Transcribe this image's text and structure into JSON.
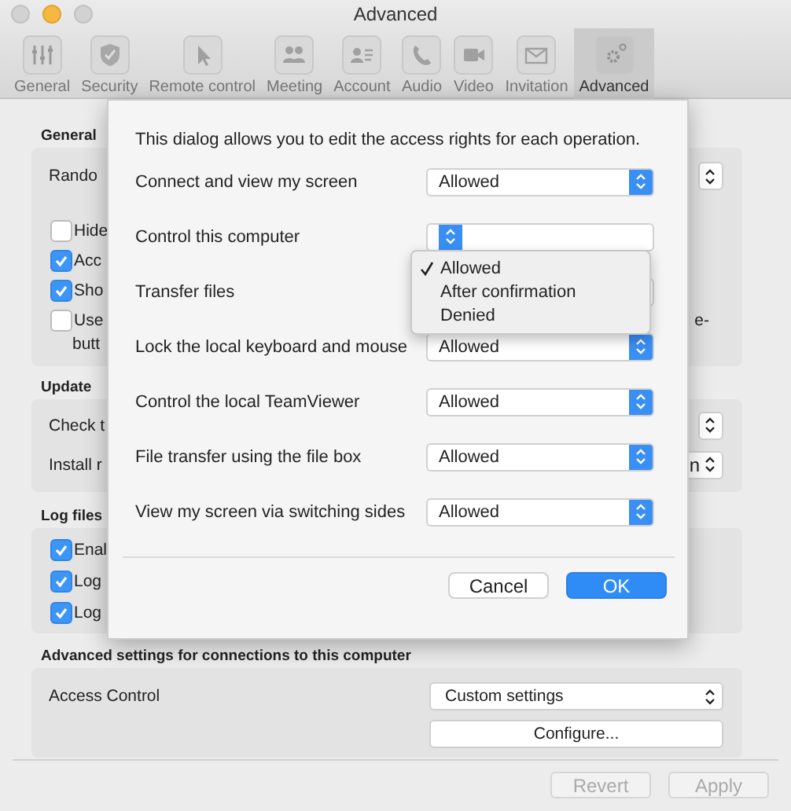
{
  "window": {
    "title": "Advanced"
  },
  "tabs": [
    {
      "label": "General",
      "selected": false
    },
    {
      "label": "Security",
      "selected": false
    },
    {
      "label": "Remote control",
      "selected": false
    },
    {
      "label": "Meeting",
      "selected": false
    },
    {
      "label": "Account",
      "selected": false
    },
    {
      "label": "Audio",
      "selected": false
    },
    {
      "label": "Video",
      "selected": false
    },
    {
      "label": "Invitation",
      "selected": false
    },
    {
      "label": "Advanced",
      "selected": true
    }
  ],
  "general": {
    "header": "General",
    "rows": [
      {
        "kind": "select",
        "label": "Rando"
      },
      {
        "kind": "checkbox",
        "label": "Hide",
        "checked": false
      },
      {
        "kind": "checkbox",
        "label": "Acc",
        "checked": true
      },
      {
        "kind": "checkbox",
        "label": "Sho",
        "checked": true
      },
      {
        "kind": "checkbox",
        "label": "Use",
        "checked": false,
        "continuation": "butt",
        "trailing": "e-"
      }
    ]
  },
  "update": {
    "header": "Update",
    "rows": [
      {
        "kind": "select",
        "label": "Check t"
      },
      {
        "kind": "select",
        "label": "Install r",
        "value": "n"
      }
    ]
  },
  "log_files": {
    "header": "Log files",
    "rows": [
      {
        "kind": "checkbox",
        "label": "Enal",
        "checked": true
      },
      {
        "kind": "checkbox",
        "label": "Log",
        "checked": true
      },
      {
        "kind": "checkbox",
        "label": "Log",
        "checked": true
      }
    ]
  },
  "advanced_settings": {
    "header": "Advanced settings for connections to this computer",
    "access_control": {
      "label": "Access Control",
      "value": "Custom settings"
    },
    "configure_button": "Configure..."
  },
  "footer_buttons": [
    {
      "label": "Revert",
      "disabled": true
    },
    {
      "label": "Apply",
      "disabled": true
    }
  ],
  "dialog": {
    "intro": "This dialog allows you to edit the access rights for each operation.",
    "rows": [
      {
        "label": "Connect and view my screen",
        "value": "Allowed"
      },
      {
        "label": "Control this computer"
      },
      {
        "label": "Transfer files"
      },
      {
        "label": "Lock the local keyboard and mouse",
        "value": "Allowed"
      },
      {
        "label": "Control the local TeamViewer",
        "value": "Allowed"
      },
      {
        "label": "File transfer using the file box",
        "value": "Allowed"
      },
      {
        "label": "View my screen via switching sides",
        "value": "Allowed"
      }
    ],
    "popup_menu": {
      "items": [
        {
          "label": "Allowed",
          "selected": true
        },
        {
          "label": "After confirmation",
          "selected": false
        },
        {
          "label": "Denied",
          "selected": false
        }
      ]
    },
    "buttons": [
      {
        "label": "Cancel",
        "default": false
      },
      {
        "label": "OK",
        "default": true
      }
    ]
  }
}
